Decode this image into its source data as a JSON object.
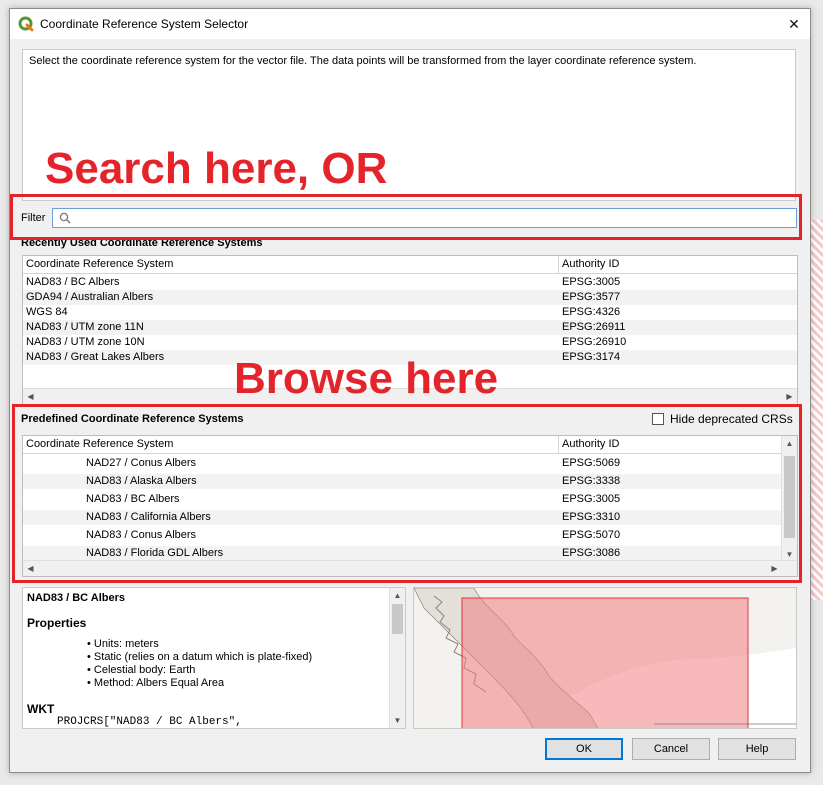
{
  "window": {
    "title": "Coordinate Reference System Selector",
    "close": "✕"
  },
  "description": "Select the coordinate reference system for the vector file. The data points will be transformed from the layer coordinate reference system.",
  "annotations": {
    "search": "Search here, OR",
    "browse": "Browse here"
  },
  "filter": {
    "label": "Filter",
    "value": "",
    "placeholder": ""
  },
  "recent": {
    "title": "Recently Used Coordinate Reference Systems",
    "columns": [
      "Coordinate Reference System",
      "Authority ID"
    ],
    "rows": [
      {
        "name": "NAD83 / BC Albers",
        "id": "EPSG:3005"
      },
      {
        "name": "GDA94 / Australian Albers",
        "id": "EPSG:3577"
      },
      {
        "name": "WGS 84",
        "id": "EPSG:4326"
      },
      {
        "name": "NAD83 / UTM zone 11N",
        "id": "EPSG:26911"
      },
      {
        "name": "NAD83 / UTM zone 10N",
        "id": "EPSG:26910"
      },
      {
        "name": "NAD83 / Great Lakes Albers",
        "id": "EPSG:3174"
      }
    ]
  },
  "predefined": {
    "title": "Predefined Coordinate Reference Systems",
    "hide_deprecated_label": "Hide deprecated CRSs",
    "hide_deprecated_checked": false,
    "columns": [
      "Coordinate Reference System",
      "Authority ID"
    ],
    "rows": [
      {
        "name": "NAD27 / Conus Albers",
        "id": "EPSG:5069"
      },
      {
        "name": "NAD83 / Alaska Albers",
        "id": "EPSG:3338"
      },
      {
        "name": "NAD83 / BC Albers",
        "id": "EPSG:3005"
      },
      {
        "name": "NAD83 / California Albers",
        "id": "EPSG:3310"
      },
      {
        "name": "NAD83 / Conus Albers",
        "id": "EPSG:5070"
      },
      {
        "name": "NAD83 / Florida GDL Albers",
        "id": "EPSG:3086"
      }
    ]
  },
  "details": {
    "name": "NAD83 / BC Albers",
    "properties_title": "Properties",
    "properties": [
      "Units: meters",
      "Static (relies on a datum which is plate-fixed)",
      "Celestial body: Earth",
      "Method: Albers Equal Area"
    ],
    "wkt_title": "WKT",
    "wkt_line": "PROJCRS[\"NAD83 / BC Albers\","
  },
  "buttons": {
    "ok": "OK",
    "cancel": "Cancel",
    "help": "Help"
  },
  "colors": {
    "annotation": "#e3242b",
    "extent": "#f08080",
    "accent": "#0078d7"
  }
}
